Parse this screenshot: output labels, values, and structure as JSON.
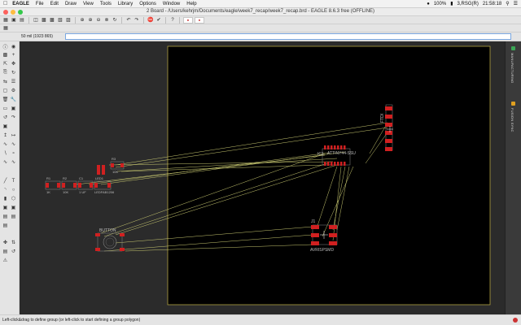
{
  "menubar": {
    "apple_icon": "apple-icon",
    "app_name": "EAGLE",
    "items": [
      "File",
      "Edit",
      "Draw",
      "View",
      "Tools",
      "Library",
      "Options",
      "Window",
      "Help"
    ],
    "battery": "100%",
    "user": "3,RSG(R)",
    "clock": "21:58:18"
  },
  "window": {
    "title": "2 Board - /Users/kehrjm/Documents/eagle/week7_recap/week7_recap.brd - EAGLE 8.6.3 free (OFFLINE)"
  },
  "cmd": {
    "coordinate": "50 mil (1923 865)",
    "command_value": ""
  },
  "rightbar": {
    "tab1": "MANUFACTURING",
    "tab2": "FUSION SYNC"
  },
  "status": {
    "text": "Left-click&drag to define group (or left-click to start defining a group polygon)"
  },
  "board": {
    "parts": {
      "r1": {
        "name": "R1",
        "value": "1K"
      },
      "r2": {
        "name": "R2",
        "value": "10K"
      },
      "c1": {
        "name": "C1",
        "value": "1 UF"
      },
      "led1": {
        "name": "LED1",
        "value": "LEDFAB1206"
      },
      "r3": {
        "name": "R3",
        "value": "10K"
      },
      "ic1": {
        "name": "IC1",
        "value": "ATTINY44-SSU"
      },
      "button": {
        "name": "BUTTON"
      },
      "j1": {
        "name": "J1",
        "value": "AVRISPSMD"
      },
      "ftdi": {
        "name": "FTDI"
      }
    }
  },
  "colors": {
    "pad": "#d02020",
    "airwire": "#c8c870",
    "outline": "#b0a040",
    "board_bg": "#000000"
  }
}
